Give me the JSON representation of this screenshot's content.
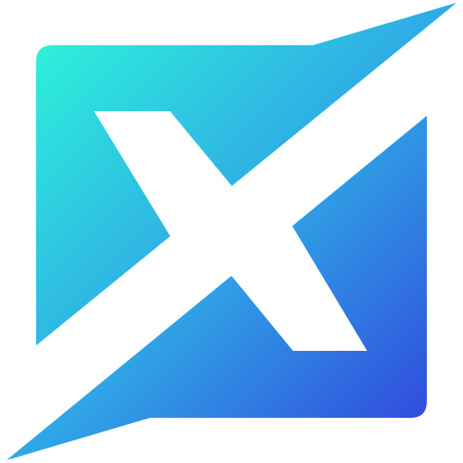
{
  "logo": {
    "icon": "x-logo-icon",
    "colors": {
      "gradient_start": "#2EF0DA",
      "gradient_mid": "#2FA8E6",
      "gradient_end": "#3147DD",
      "letter": "#FFFFFF",
      "background": "#FFFFFF"
    }
  }
}
